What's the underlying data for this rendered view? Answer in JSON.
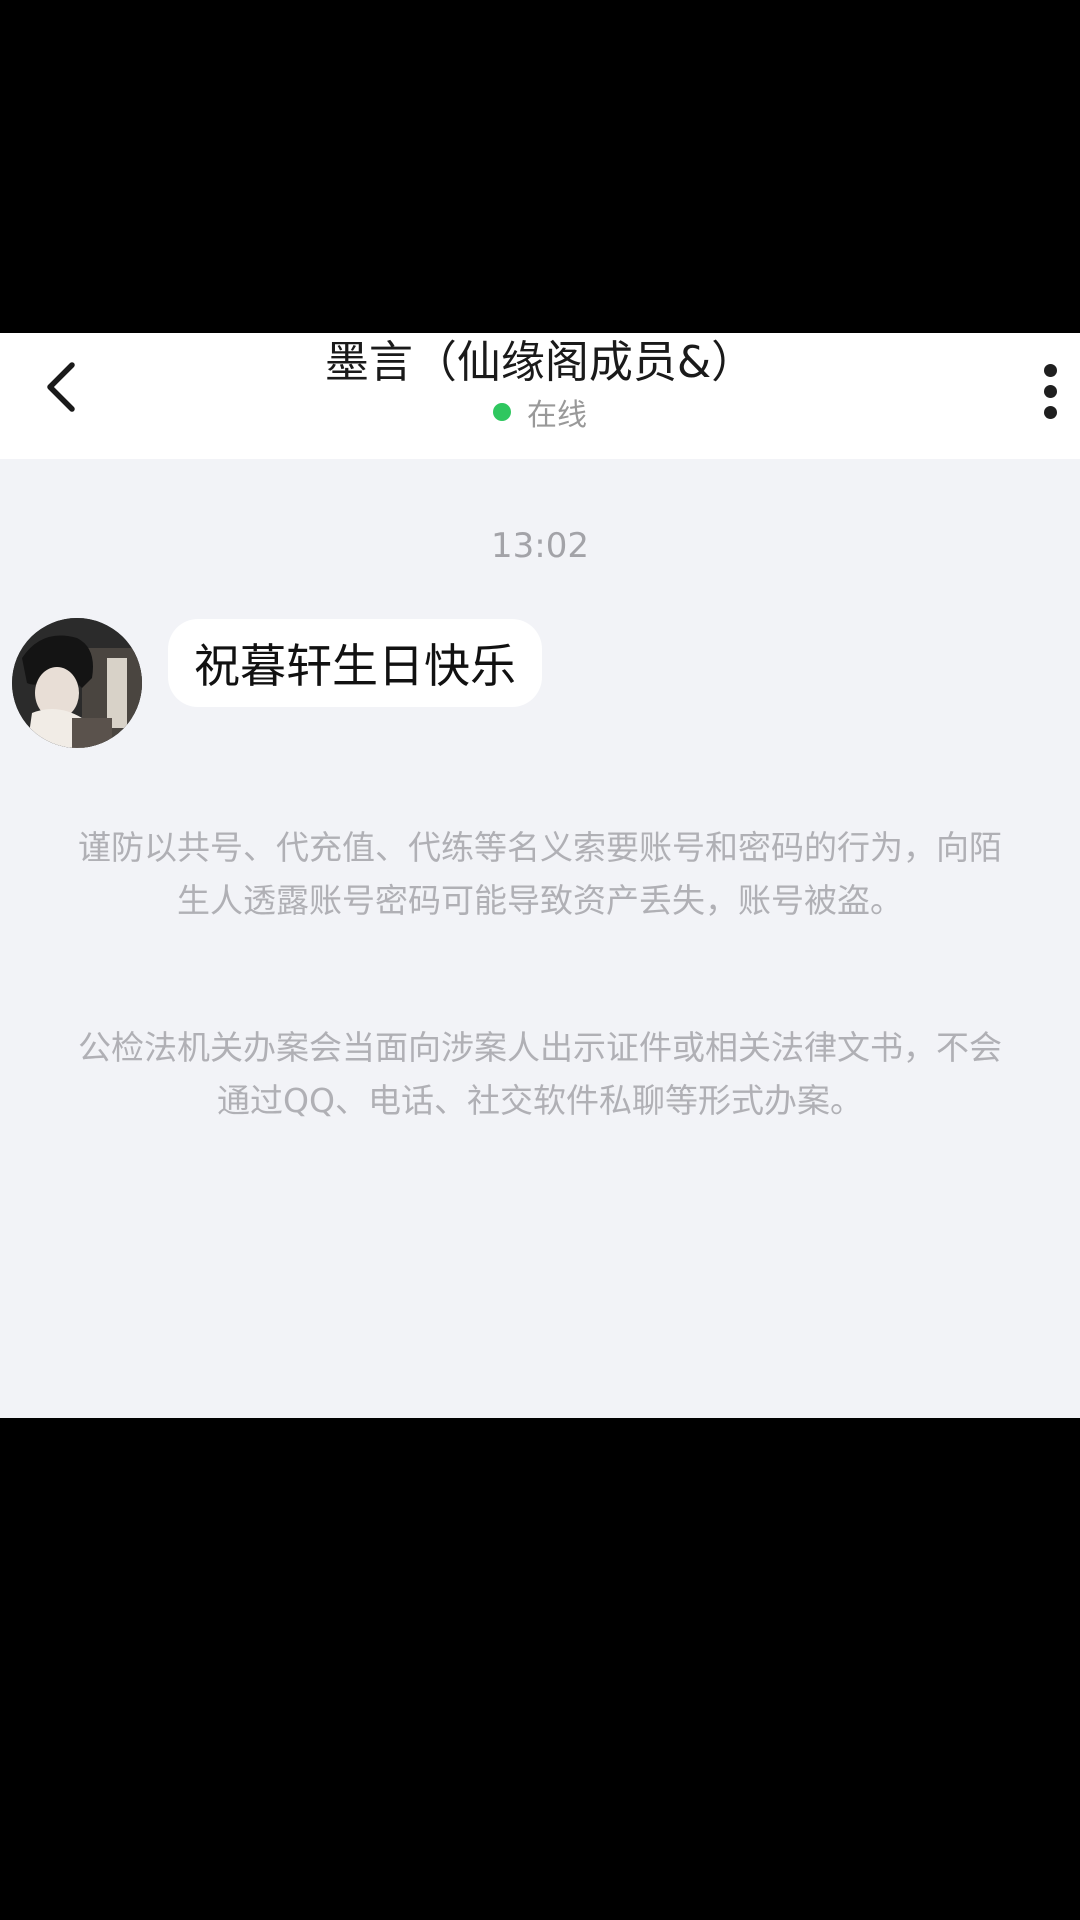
{
  "header": {
    "title": "墨言（仙缘阁成员&）",
    "status": "在线"
  },
  "chat": {
    "timestamp": "13:02",
    "messages": [
      {
        "sender": "other",
        "text": "祝暮轩生日快乐"
      }
    ]
  },
  "notices": [
    "谨防以共号、代充值、代练等名义索要账号和密码的行为，向陌生人透露账号密码可能导致资产丢失，账号被盗。",
    "公检法机关办案会当面向涉案人出示证件或相关法律文书，不会通过QQ、电话、社交软件私聊等形式办案。"
  ],
  "colors": {
    "status_dot": "#2fc75f",
    "chat_background": "#f2f3f7",
    "header_background": "#ffffff",
    "notice_text": "#b0b0b5"
  },
  "icons": {
    "back": "chevron-left-icon",
    "more": "more-vertical-icon",
    "status": "online-dot-icon"
  }
}
